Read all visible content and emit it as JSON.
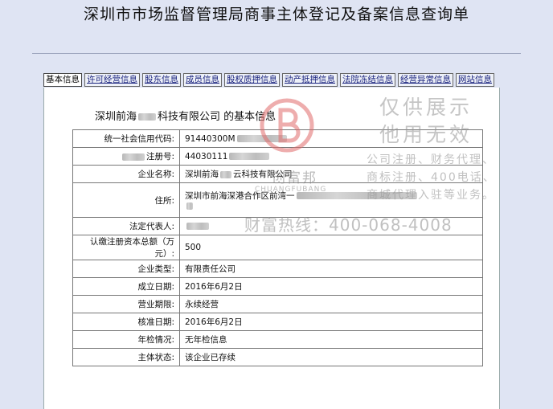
{
  "page_title": "深圳市市场监督管理局商事主体登记及备案信息查询单",
  "tabs": [
    {
      "label": "基本信息",
      "active": true
    },
    {
      "label": "许可经营信息",
      "active": false
    },
    {
      "label": "股东信息",
      "active": false
    },
    {
      "label": "成员信息",
      "active": false
    },
    {
      "label": "股权质押信息",
      "active": false
    },
    {
      "label": "动产抵押信息",
      "active": false
    },
    {
      "label": "法院冻结信息",
      "active": false
    },
    {
      "label": "经营异常信息",
      "active": false
    },
    {
      "label": "网站信息",
      "active": false
    }
  ],
  "section": {
    "title_prefix": "深圳前海",
    "title_middle": "科技有限公司",
    "title_suffix": " 的基本信息"
  },
  "rows": {
    "credit_code": {
      "label": "统一社会信用代码:",
      "value": "91440300M"
    },
    "reg_no": {
      "label": "注册号:",
      "value": "44030111"
    },
    "name": {
      "label": "企业名称:",
      "value_prefix": "深圳前海",
      "value_suffix": "云科技有限公司"
    },
    "address": {
      "label": "住所:",
      "value": "深圳市前海深港合作区前湾一"
    },
    "legal_rep": {
      "label": "法定代表人:",
      "value": ""
    },
    "capital": {
      "label": "认缴注册资本总额（万元）:",
      "value": "500"
    },
    "type": {
      "label": "企业类型:",
      "value": "有限责任公司"
    },
    "founded": {
      "label": "成立日期:",
      "value": "2016年6月2日"
    },
    "term": {
      "label": "营业期限:",
      "value": "永续经营"
    },
    "approved": {
      "label": "核准日期:",
      "value": "2016年6月2日"
    },
    "inspection": {
      "label": "年检情况:",
      "value": "无年检信息"
    },
    "status": {
      "label": "主体状态:",
      "value": "该企业已存续"
    }
  },
  "watermark": {
    "brand": "创富邦",
    "pinyin": "CHUANGFUBANG",
    "line1": "仅供展示",
    "line2": "他用无效",
    "line3": "公司注册、财务代理、",
    "line4": "商标注册、400电话、",
    "line5": "商城代理入驻等业务。",
    "hotline": "财富热线：400-068-4008"
  },
  "colors": {
    "background": "#dfe4f3",
    "tab_link": "#1a237e",
    "logo_red": "#e06a6a"
  }
}
